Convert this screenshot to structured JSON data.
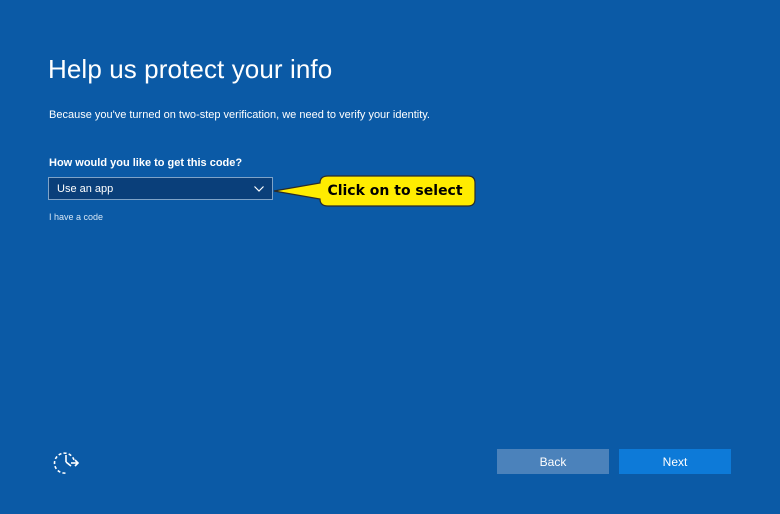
{
  "page": {
    "title": "Help us protect your info",
    "description": "Because you've turned on two-step verification, we need to verify your identity."
  },
  "form": {
    "question": "How would you like to get this code?",
    "method_select": {
      "selected": "Use an app"
    },
    "have_code_link": "I have a code"
  },
  "annotation": {
    "callout_text": "Click on to select"
  },
  "footer": {
    "accessibility_icon": "ease-of-access-icon",
    "back_label": "Back",
    "next_label": "Next"
  },
  "colors": {
    "background": "#0b5aa6",
    "select_bg": "#0a3f7a",
    "back_button": "#4b82bb",
    "next_button": "#0d7ad8",
    "callout_fill": "#ffec00"
  }
}
